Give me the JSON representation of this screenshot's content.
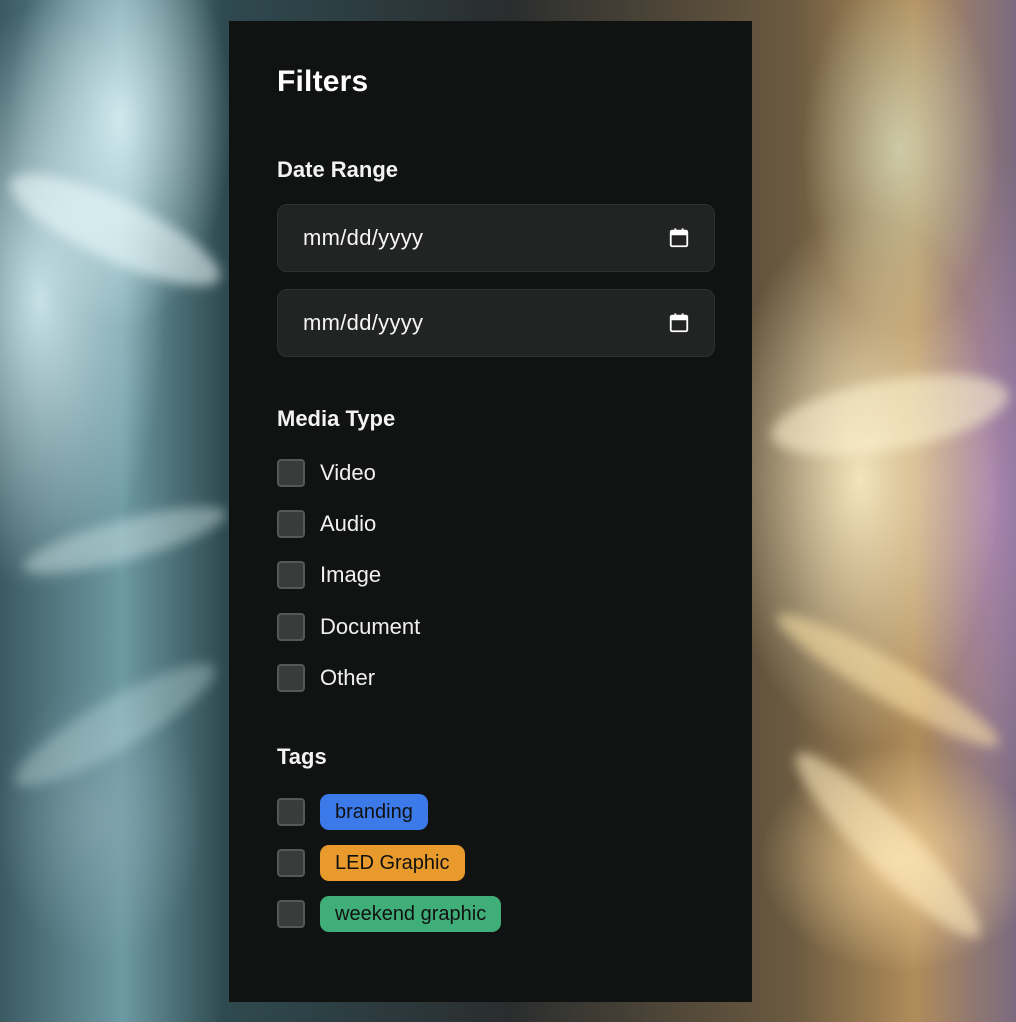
{
  "panel": {
    "title": "Filters"
  },
  "date_range": {
    "label": "Date Range",
    "start": {
      "placeholder": "mm/dd/yyyy",
      "icon": "calendar-icon"
    },
    "end": {
      "placeholder": "mm/dd/yyyy",
      "icon": "calendar-icon"
    }
  },
  "media_type": {
    "label": "Media Type",
    "options": [
      {
        "label": "Video",
        "checked": false
      },
      {
        "label": "Audio",
        "checked": false
      },
      {
        "label": "Image",
        "checked": false
      },
      {
        "label": "Document",
        "checked": false
      },
      {
        "label": "Other",
        "checked": false
      }
    ]
  },
  "tags": {
    "label": "Tags",
    "items": [
      {
        "label": "branding",
        "color": "#3b7ae8",
        "checked": false
      },
      {
        "label": "LED Graphic",
        "color": "#e89a2c",
        "checked": false
      },
      {
        "label": "weekend graphic",
        "color": "#3fae78",
        "checked": false
      }
    ]
  }
}
